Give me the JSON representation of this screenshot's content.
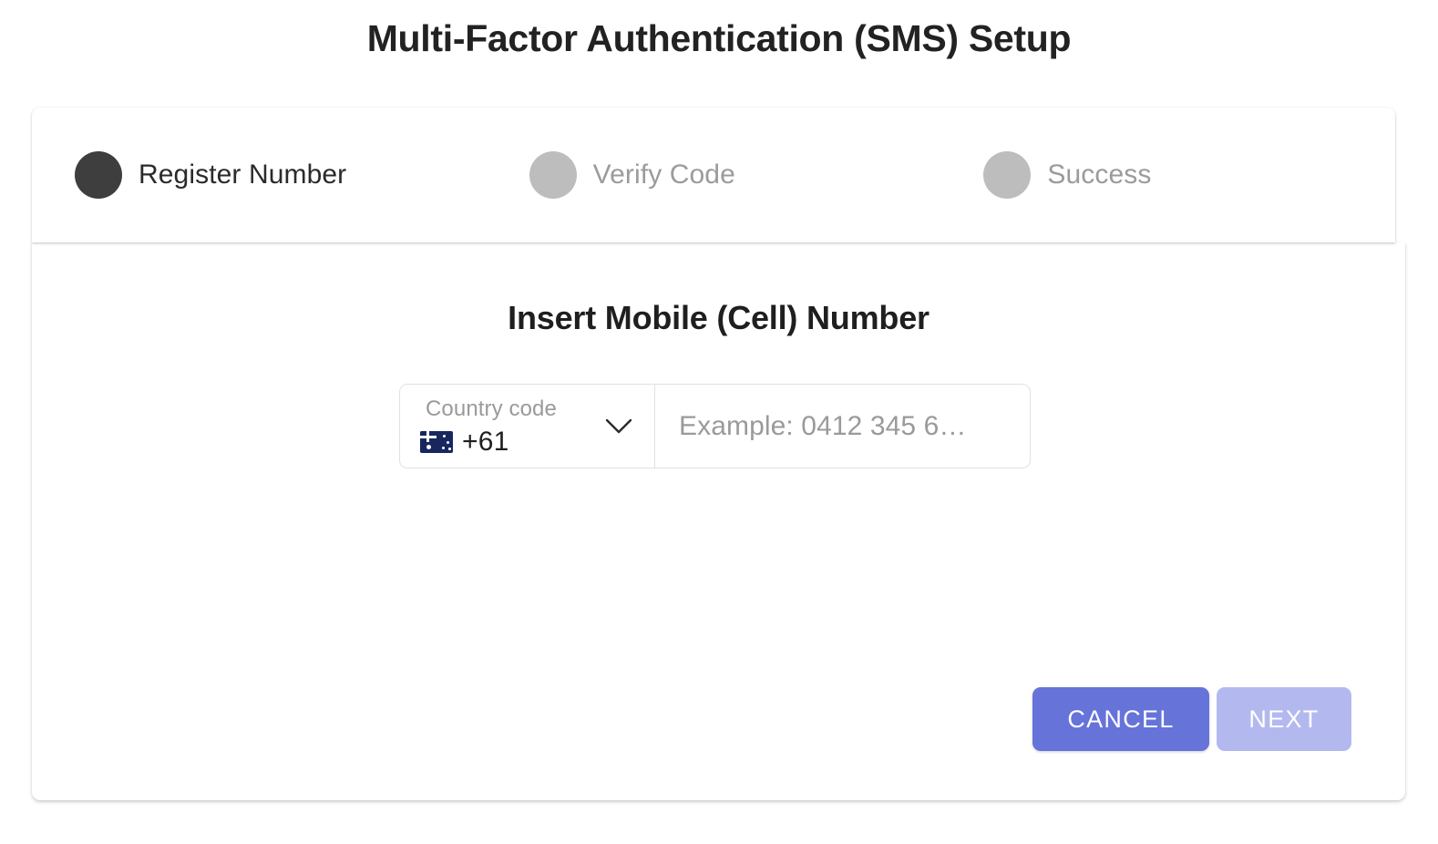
{
  "page": {
    "title": "Multi-Factor Authentication (SMS) Setup",
    "background_color": "#ffffff"
  },
  "stepper": {
    "steps": [
      {
        "label": "Register Number",
        "state": "active",
        "dot_color": "#3e3e3e",
        "text_color": "#2b2b2b"
      },
      {
        "label": "Verify Code",
        "state": "inactive",
        "dot_color": "#bdbdbd",
        "text_color": "#9b9b9b"
      },
      {
        "label": "Success",
        "state": "inactive",
        "dot_color": "#bdbdbd",
        "text_color": "#9b9b9b"
      }
    ]
  },
  "content": {
    "heading": "Insert Mobile (Cell) Number",
    "country_select": {
      "label": "Country code",
      "flag_icon": "australia-flag-icon",
      "flag_emoji": "🇦🇺",
      "value": "+61",
      "chevron_icon": "chevron-down-icon"
    },
    "phone_input": {
      "placeholder": "Example: 0412 345 6…",
      "value": ""
    }
  },
  "actions": {
    "cancel_label": "CANCEL",
    "next_label": "NEXT",
    "cancel_color": "#6673d9",
    "next_color": "#b3b9ef"
  }
}
